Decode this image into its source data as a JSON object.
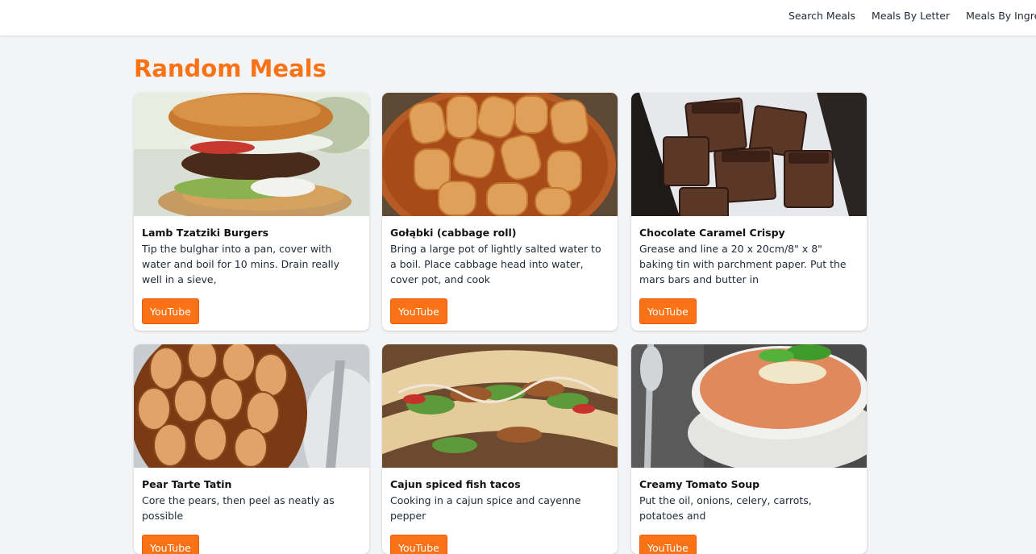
{
  "nav": {
    "items": [
      "Search Meals",
      "Meals By Letter",
      "Meals By Ingredients"
    ]
  },
  "page": {
    "title": "Random Meals"
  },
  "meals": [
    {
      "name": "Lamb Tzatziki Burgers",
      "description": "Tip the bulghar into a pan, cover with water and boil for 10 mins. Drain really well in a sieve,",
      "button": "YouTube"
    },
    {
      "name": "Gołąbki (cabbage roll)",
      "description": "Bring a large pot of lightly salted water to a boil. Place cabbage head into water, cover pot, and cook",
      "button": "YouTube"
    },
    {
      "name": "Chocolate Caramel Crispy",
      "description": "Grease and line a 20 x 20cm/8\" x 8\" baking tin with parchment paper. Put the mars bars and butter in",
      "button": "YouTube"
    },
    {
      "name": "Pear Tarte Tatin",
      "description": "Core the pears, then peel as neatly as possible",
      "button": "YouTube"
    },
    {
      "name": "Cajun spiced fish tacos",
      "description": "Cooking in a cajun spice and cayenne pepper",
      "button": "YouTube"
    },
    {
      "name": "Creamy Tomato Soup",
      "description": "Put the oil, onions, celery, carrots, potatoes and",
      "button": "YouTube"
    }
  ],
  "colors": {
    "accent": "#f97316",
    "background": "#f3f4f6"
  }
}
